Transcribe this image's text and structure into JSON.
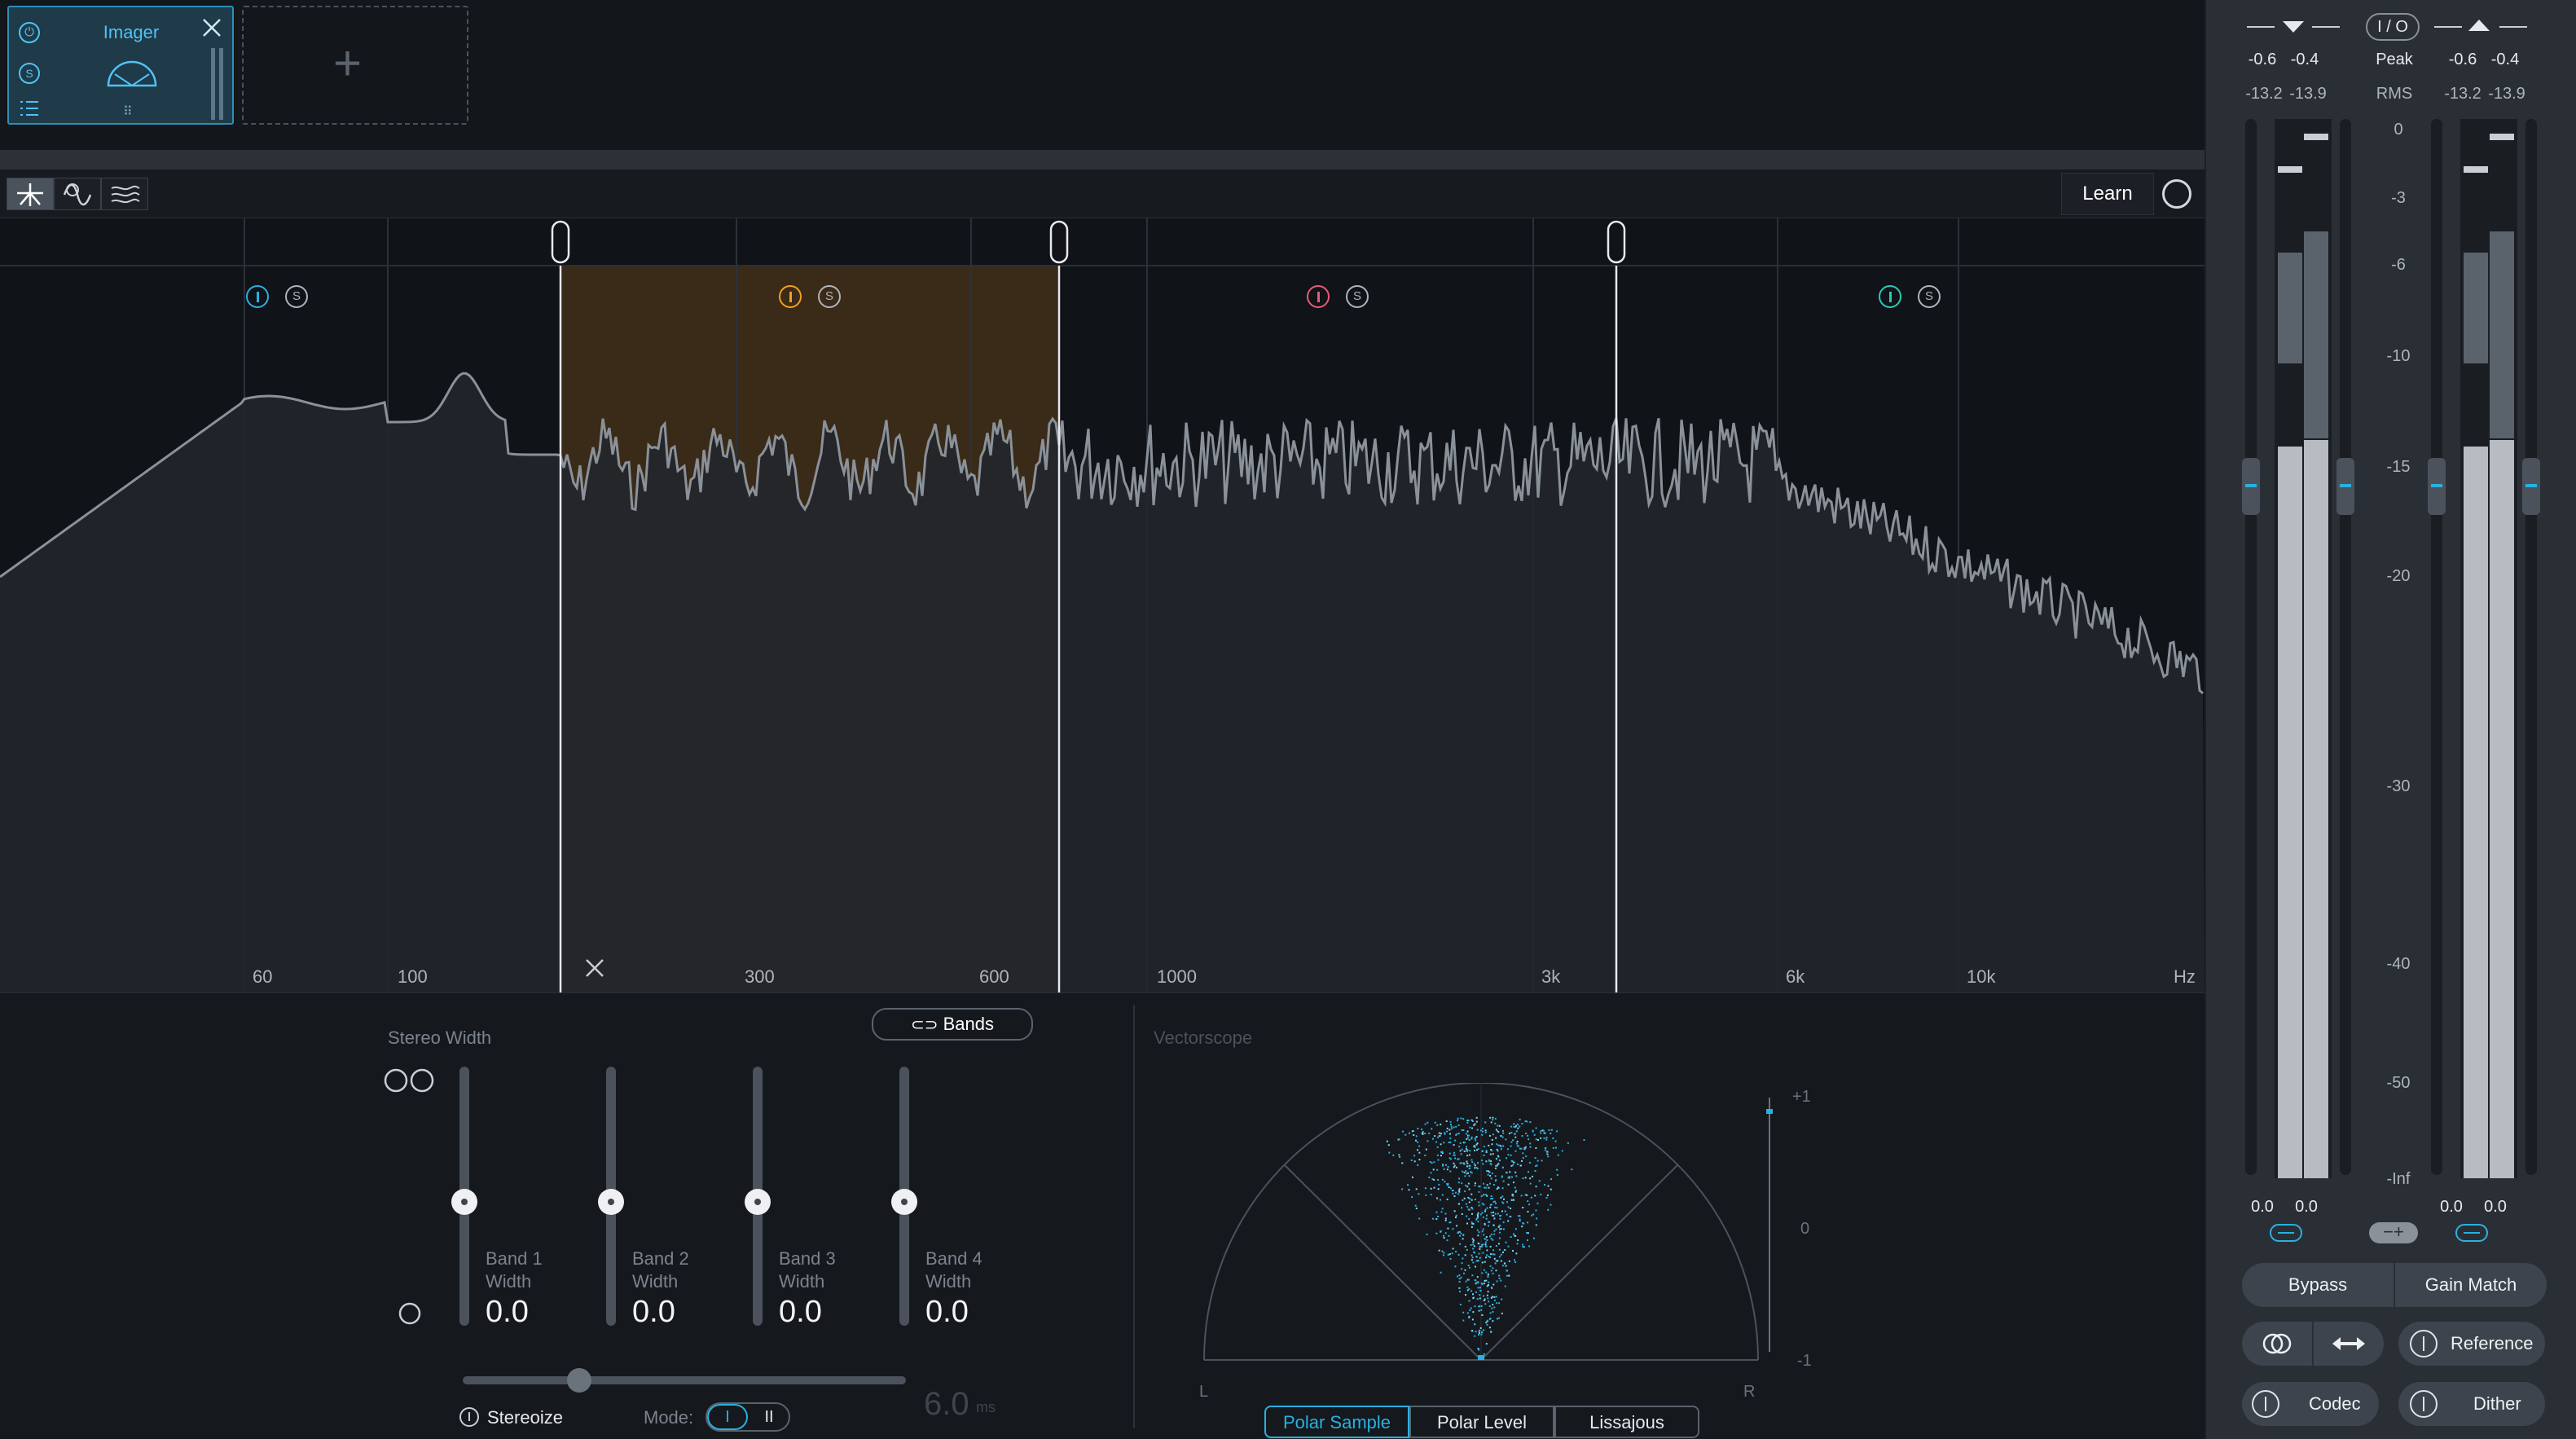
{
  "module": {
    "name": "Imager",
    "power_icon": "power-icon",
    "solo_label": "S",
    "add_icon": "+"
  },
  "toolbar": {
    "learn_label": "Learn"
  },
  "spectrum": {
    "freq_labels": [
      "60",
      "100",
      "300",
      "600",
      "1000",
      "3k",
      "6k",
      "10k",
      "Hz"
    ],
    "band_solo_label": "S",
    "colors": {
      "band1": "#2ab0e0",
      "band2": "#f0a020",
      "band3": "#e85a78",
      "band4": "#2ec8b8",
      "highlight": "#3a2a18"
    },
    "remove_band_label": "×"
  },
  "stereo": {
    "title": "Stereo Width",
    "bands_button": "Bands",
    "bands": [
      {
        "label": "Band 1",
        "sub": "Width",
        "value": "0.0"
      },
      {
        "label": "Band 2",
        "sub": "Width",
        "value": "0.0"
      },
      {
        "label": "Band 3",
        "sub": "Width",
        "value": "0.0"
      },
      {
        "label": "Band 4",
        "sub": "Width",
        "value": "0.0"
      }
    ],
    "stereoize_label": "Stereoize",
    "mode_label": "Mode:",
    "mode_options": [
      "I",
      "II"
    ],
    "delay_value": "6.0",
    "delay_unit": "ms"
  },
  "vectorscope": {
    "title": "Vectorscope",
    "scale": [
      "+1",
      "0",
      "-1"
    ],
    "left": "L",
    "right": "R",
    "tabs": [
      "Polar Sample",
      "Polar Level",
      "Lissajous"
    ],
    "active_tab": "Polar Sample"
  },
  "meters": {
    "io_label": "I / O",
    "peak_label": "Peak",
    "rms_label": "RMS",
    "in_peak": [
      "-0.6",
      "-0.4"
    ],
    "in_rms": [
      "-13.2",
      "-13.9"
    ],
    "out_peak": [
      "-0.6",
      "-0.4"
    ],
    "out_rms": [
      "-13.2",
      "-13.9"
    ],
    "scale": [
      "0",
      "-3",
      "-6",
      "-10",
      "-15",
      "-20",
      "-30",
      "-40",
      "-50",
      "-Inf"
    ],
    "in_gain": [
      "0.0",
      "0.0"
    ],
    "out_gain": [
      "0.0",
      "0.0"
    ],
    "buttons": {
      "bypass": "Bypass",
      "gain_match": "Gain Match",
      "reference": "Reference",
      "codec": "Codec",
      "dither": "Dither"
    }
  }
}
